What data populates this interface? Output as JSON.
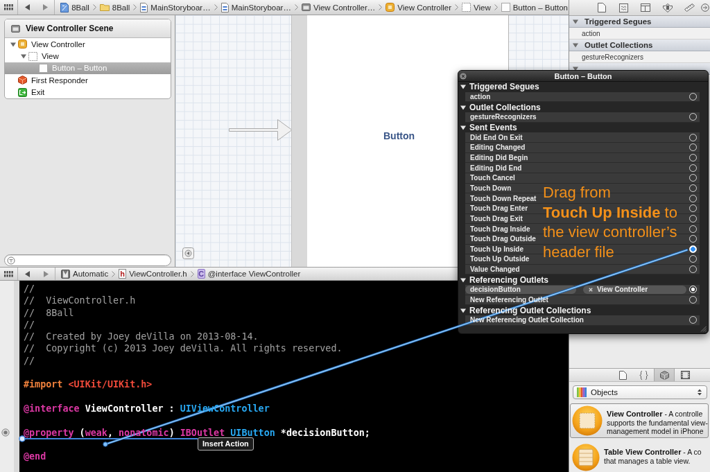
{
  "jump_bar": {
    "items": [
      {
        "kind": "project",
        "label": "8Ball"
      },
      {
        "kind": "folder",
        "label": "8Ball"
      },
      {
        "kind": "storyboard",
        "label": "MainStoryboar…"
      },
      {
        "kind": "storyboard",
        "label": "MainStoryboar…"
      },
      {
        "kind": "scene",
        "label": "View Controller…"
      },
      {
        "kind": "view_controller",
        "label": "View Controller"
      },
      {
        "kind": "view",
        "label": "View"
      },
      {
        "kind": "button",
        "label": "Button – Button"
      }
    ]
  },
  "outline": {
    "title": "View Controller Scene",
    "items": [
      {
        "kind": "view_controller",
        "label": "View Controller",
        "expanded": true,
        "selected": false,
        "children": [
          {
            "kind": "view",
            "label": "View",
            "expanded": true,
            "selected": false,
            "children": [
              {
                "kind": "button",
                "label": "Button – Button",
                "selected": true
              }
            ]
          }
        ]
      },
      {
        "kind": "first_responder",
        "label": "First Responder",
        "selected": false
      },
      {
        "kind": "exit",
        "label": "Exit",
        "selected": false
      }
    ]
  },
  "canvas": {
    "button_label": "Button"
  },
  "editor_jump_bar": {
    "items": [
      {
        "kind": "assistant",
        "label": "Automatic"
      },
      {
        "kind": "header",
        "glyph": "h",
        "label": "ViewController.h"
      },
      {
        "kind": "class",
        "glyph": "C",
        "label": "@interface ViewController"
      }
    ]
  },
  "code": {
    "lines": [
      {
        "connected": false,
        "segments": [
          {
            "kind": "comment",
            "text": "//"
          }
        ]
      },
      {
        "connected": false,
        "segments": [
          {
            "kind": "comment",
            "text": "//  ViewController.h"
          }
        ]
      },
      {
        "connected": false,
        "segments": [
          {
            "kind": "comment",
            "text": "//  8Ball"
          }
        ]
      },
      {
        "connected": false,
        "segments": [
          {
            "kind": "comment",
            "text": "//"
          }
        ]
      },
      {
        "connected": false,
        "segments": [
          {
            "kind": "comment",
            "text": "//  Created by Joey deVilla on 2013-08-14."
          }
        ]
      },
      {
        "connected": false,
        "segments": [
          {
            "kind": "comment",
            "text": "//  Copyright (c) 2013 Joey deVilla. All rights reserved."
          }
        ]
      },
      {
        "connected": false,
        "segments": [
          {
            "kind": "comment",
            "text": "//"
          }
        ]
      },
      {
        "connected": false
      },
      {
        "connected": false,
        "segments": [
          {
            "kind": "preprocessor",
            "text": "#import "
          },
          {
            "kind": "string",
            "text": "<UIKit/UIKit.h>"
          }
        ]
      },
      {
        "connected": false
      },
      {
        "connected": false,
        "segments": [
          {
            "kind": "keyword",
            "text": "@interface"
          },
          {
            "kind": "plain",
            "text": " ViewController : "
          },
          {
            "kind": "class",
            "text": "UIViewController"
          }
        ]
      },
      {
        "connected": false
      },
      {
        "connected": true,
        "segments": [
          {
            "kind": "keyword",
            "text": "@property"
          },
          {
            "kind": "plain",
            "text": " ("
          },
          {
            "kind": "keyword",
            "text": "weak"
          },
          {
            "kind": "plain",
            "text": ", "
          },
          {
            "kind": "keyword",
            "text": "nonatomic"
          },
          {
            "kind": "plain",
            "text": ") "
          },
          {
            "kind": "keyword",
            "text": "IBOutlet "
          },
          {
            "kind": "class",
            "text": "UIButton"
          },
          {
            "kind": "plain",
            "text": " *decisionButton;"
          }
        ]
      },
      {
        "connected": false
      },
      {
        "connected": false,
        "segments": [
          {
            "kind": "keyword",
            "text": "@end"
          }
        ]
      }
    ]
  },
  "inspector": {
    "tabs": [
      {
        "kind": "file"
      },
      {
        "kind": "quick_help"
      },
      {
        "kind": "identity"
      },
      {
        "kind": "attributes"
      },
      {
        "kind": "size"
      },
      {
        "kind": "connections"
      }
    ],
    "sections": [
      {
        "title": "Triggered Segues",
        "expanded": true,
        "rows": [
          "action"
        ]
      },
      {
        "title": "Outlet Collections",
        "expanded": true,
        "rows": [
          "gestureRecognizers"
        ]
      },
      {
        "expanded": true
      }
    ]
  },
  "library": {
    "tabs": [
      {
        "kind": "file_template",
        "selected": false
      },
      {
        "kind": "code_snippet",
        "selected": false
      },
      {
        "kind": "object",
        "selected": true
      },
      {
        "kind": "media",
        "selected": false
      }
    ],
    "filter": "Objects",
    "items": [
      {
        "kind": "view_controller",
        "selected": true,
        "text": "**View Controller** - A controlle\nsupports the fundamental view-\nmanagement model in iPhone"
      },
      {
        "kind": "table_view_controller",
        "selected": false,
        "text": "**Table View Controller** - A co\nthat manages a table view."
      }
    ]
  },
  "connections_popup": {
    "title": "Button – Button",
    "sections": [
      {
        "title": "Triggered Segues",
        "expanded": true,
        "rows": [
          {
            "label": "action",
            "connected": false,
            "dragging": false
          }
        ]
      },
      {
        "title": "Outlet Collections",
        "expanded": true,
        "rows": [
          {
            "label": "gestureRecognizers",
            "connected": false,
            "dragging": false
          }
        ]
      },
      {
        "title": "Sent Events",
        "expanded": true,
        "rows": [
          {
            "label": "Did End On Exit",
            "connected": false,
            "dragging": false
          },
          {
            "label": "Editing Changed",
            "connected": false,
            "dragging": false
          },
          {
            "label": "Editing Did Begin",
            "connected": false,
            "dragging": false
          },
          {
            "label": "Editing Did End",
            "connected": false,
            "dragging": false
          },
          {
            "label": "Touch Cancel",
            "connected": false,
            "dragging": false
          },
          {
            "label": "Touch Down",
            "connected": false,
            "dragging": false
          },
          {
            "label": "Touch Down Repeat",
            "connected": false,
            "dragging": false
          },
          {
            "label": "Touch Drag Enter",
            "connected": false,
            "dragging": false
          },
          {
            "label": "Touch Drag Exit",
            "connected": false,
            "dragging": false
          },
          {
            "label": "Touch Drag Inside",
            "connected": false,
            "dragging": false
          },
          {
            "label": "Touch Drag Outside",
            "connected": false,
            "dragging": false
          },
          {
            "label": "Touch Up Inside",
            "connected": false,
            "dragging": true
          },
          {
            "label": "Touch Up Outside",
            "connected": false,
            "dragging": false
          },
          {
            "label": "Value Changed",
            "connected": false,
            "dragging": false
          }
        ]
      },
      {
        "title": "Referencing Outlets",
        "expanded": true,
        "rows": [
          {
            "label": "decisionButton",
            "connected": true,
            "dragging": false,
            "target": "View Controller"
          },
          {
            "label": "New Referencing Outlet",
            "connected": false,
            "dragging": false
          }
        ]
      },
      {
        "title": "Referencing Outlet Collections",
        "expanded": true,
        "rows": [
          {
            "label": "New Referencing Outlet Collection",
            "connected": false,
            "dragging": false
          }
        ]
      }
    ]
  },
  "annotation": {
    "text": "Drag from\n**Touch Up Inside** to\nthe view controller’s\nheader file"
  },
  "tooltip": {
    "text": "Insert Action"
  }
}
